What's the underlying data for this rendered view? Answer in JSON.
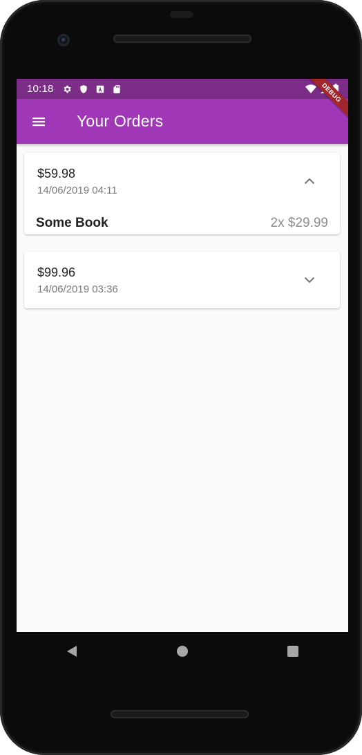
{
  "status_bar": {
    "time": "10:18",
    "left_icons": [
      "settings-icon",
      "shield-icon",
      "a-box-icon",
      "sd-card-icon"
    ],
    "right_icons": [
      "wifi-icon",
      "signal-icon",
      "battery-icon"
    ]
  },
  "app_bar": {
    "title": "Your Orders",
    "menu_icon": "menu-icon",
    "color": "#a037b6",
    "status_color": "#7b2d87"
  },
  "debug_banner": "DEBUG",
  "orders": [
    {
      "amount": "$59.98",
      "date": "14/06/2019 04:11",
      "expanded": true,
      "toggle_icon": "chevron-up-icon",
      "items": [
        {
          "title": "Some Book",
          "quantity_price": "2x $29.99"
        }
      ]
    },
    {
      "amount": "$99.96",
      "date": "14/06/2019 03:36",
      "expanded": false,
      "toggle_icon": "chevron-down-icon",
      "items": []
    }
  ],
  "nav_bar": {
    "buttons": [
      "back-icon",
      "home-icon",
      "recents-icon"
    ]
  }
}
